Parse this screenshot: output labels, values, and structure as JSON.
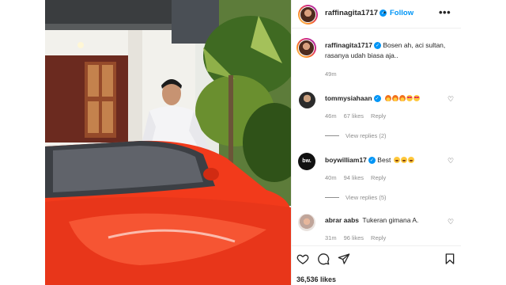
{
  "post": {
    "author": "raffinagita1717",
    "follow_label": "Follow",
    "more_label": "•••",
    "separator": "•"
  },
  "caption": {
    "username": "raffinagita1717",
    "text": " Bosen ah, aci sultan, rasanya udah biasa aja..",
    "time": "49m"
  },
  "comments": [
    {
      "username": "tommysiahaan",
      "text": "",
      "emojis": [
        "fire",
        "fire",
        "fire",
        "heart-eyes",
        "heart-eyes"
      ],
      "time": "46m",
      "likes": "67 likes",
      "reply": "Reply",
      "view_replies": "View replies (2)"
    },
    {
      "username": "boywilliam17",
      "text": "Best",
      "emojis": [
        "laugh",
        "laugh",
        "laugh"
      ],
      "time": "40m",
      "likes": "94 likes",
      "reply": "Reply",
      "view_replies": "View replies (5)"
    },
    {
      "username": "abrar aabs",
      "text": "Tukeran gimana A.",
      "emojis": [],
      "time": "31m",
      "likes": "96 likes",
      "reply": "Reply"
    }
  ],
  "actions": {
    "like_icon": "heart-icon",
    "comment_icon": "comment-icon",
    "share_icon": "share-icon",
    "save_icon": "bookmark-icon"
  },
  "likes_count": "36,536 likes",
  "colors": {
    "accent": "#0095f6",
    "meta": "#8e8e8e",
    "car": "#f23a1b"
  },
  "avatars": {
    "boywilliam_badge": "bw."
  }
}
